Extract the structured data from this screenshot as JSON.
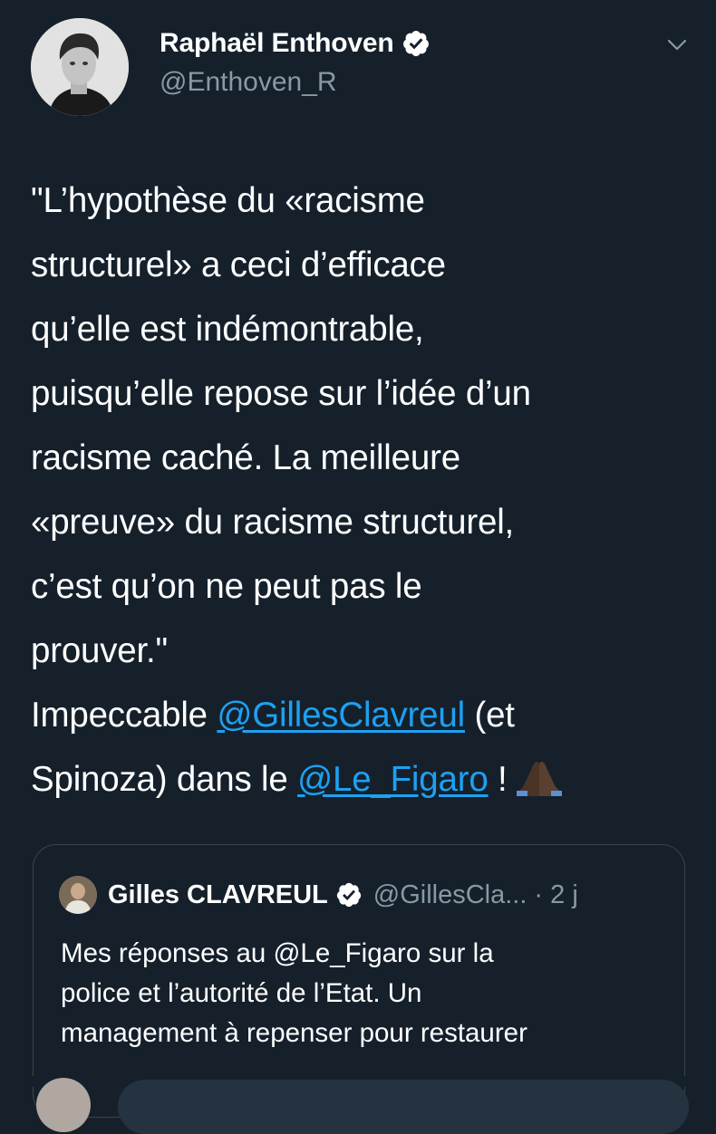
{
  "author": {
    "name": "Raphaël Enthoven",
    "handle": "@Enthoven_R",
    "verified_icon": "verified-badge-icon",
    "menu_icon": "chevron-down-icon"
  },
  "tweet": {
    "lines": [
      "\"L’hypothèse du «racisme",
      "structurel» a ceci d’efficace",
      "qu’elle est indémontrable,",
      "puisqu’elle repose sur l’idée d’un",
      "racisme caché. La meilleure",
      "«preuve» du racisme structurel,",
      "c’est qu’on ne peut pas le",
      "prouver.\""
    ],
    "line9_prefix": "Impeccable ",
    "mention_1": "@GillesClavreul",
    "line9_suffix": " (et",
    "line10_prefix": "Spinoza) dans le ",
    "mention_2": "@Le_Figaro",
    "line10_suffix": " !",
    "emoji": "folded-hands"
  },
  "quote": {
    "name": "Gilles CLAVREUL",
    "handle": "@GillesCla...",
    "time": "· 2 j",
    "lines": [
      "Mes réponses au @Le_Figaro sur la",
      "police et l’autorité de l’Etat. Un",
      "management à repenser pour restaurer"
    ]
  },
  "colors": {
    "background": "#15202b",
    "text": "#ffffff",
    "secondary": "#8899a6",
    "link": "#1da1f2",
    "border": "#38444d"
  }
}
